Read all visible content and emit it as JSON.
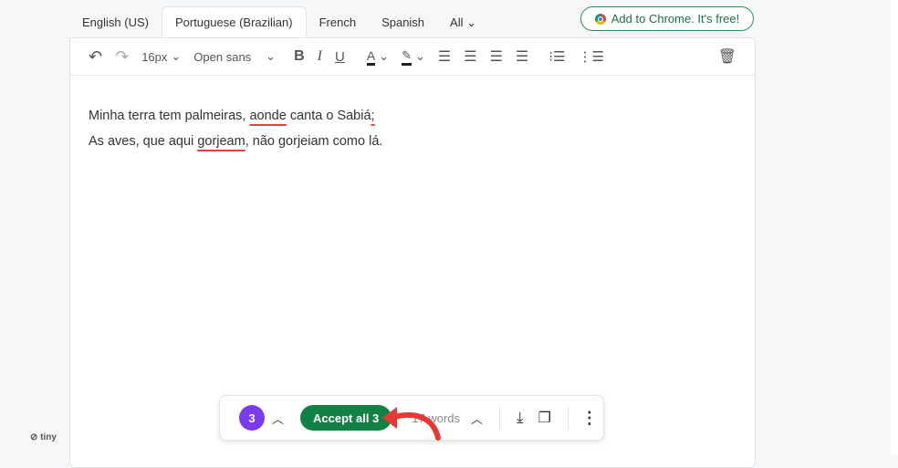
{
  "tabs": [
    {
      "label": "English (US)"
    },
    {
      "label": "Portuguese (Brazilian)"
    },
    {
      "label": "French"
    },
    {
      "label": "Spanish"
    },
    {
      "label": "All"
    }
  ],
  "chrome_button": "Add to Chrome. It's free!",
  "toolbar": {
    "font_size": "16px",
    "font_family": "Open sans",
    "bold": "B",
    "italic": "I",
    "underline": "U",
    "text_color": "A"
  },
  "content": {
    "line1": [
      "Minha terra tem palmeiras, ",
      "aonde",
      " canta o ",
      "Sabiá",
      ";"
    ],
    "line2": [
      "As aves, que aqui ",
      "gorjeam",
      ", não gorjeiam como lá."
    ]
  },
  "bottom_bar": {
    "count": "3",
    "accept_label": "Accept all 3",
    "word_count": "17 words"
  },
  "brand": "tiny",
  "colors": {
    "accent": "#118146",
    "count_badge": "#7c3aed",
    "error": "#e0443a"
  }
}
